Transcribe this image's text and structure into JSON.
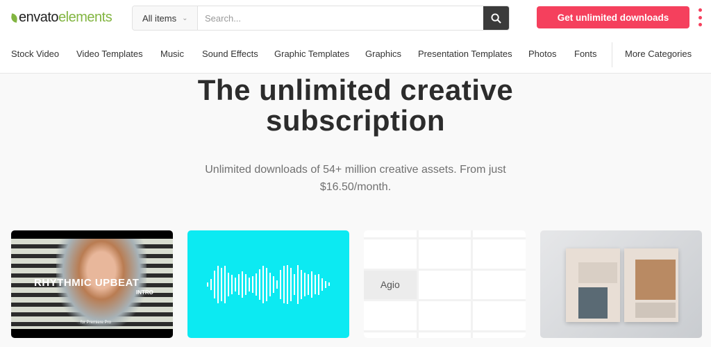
{
  "header": {
    "logo": {
      "part1": "envato",
      "part2": "elements"
    },
    "search": {
      "category": "All items",
      "placeholder": "Search...",
      "value": ""
    },
    "cta_label": "Get unlimited downloads",
    "accent_color": "#f5405d"
  },
  "nav": {
    "items": [
      "Stock Video",
      "Video Templates",
      "Music",
      "Sound Effects",
      "Graphic Templates",
      "Graphics",
      "Presentation Templates",
      "Photos",
      "Fonts"
    ],
    "more": "More Categories"
  },
  "hero": {
    "title_line1": "The unlimited creative",
    "title_line2": "subscription",
    "subtitle_line1": "Unlimited downloads of 54+ million creative assets. From just",
    "subtitle_line2": "$16.50/month."
  },
  "cards": [
    {
      "title": "RHYTHMIC UPBEAT",
      "tag": "INTRO",
      "note": "for Premiere Pro"
    },
    {
      "color": "#0ceaf2"
    },
    {
      "title": "Agio"
    },
    {}
  ]
}
